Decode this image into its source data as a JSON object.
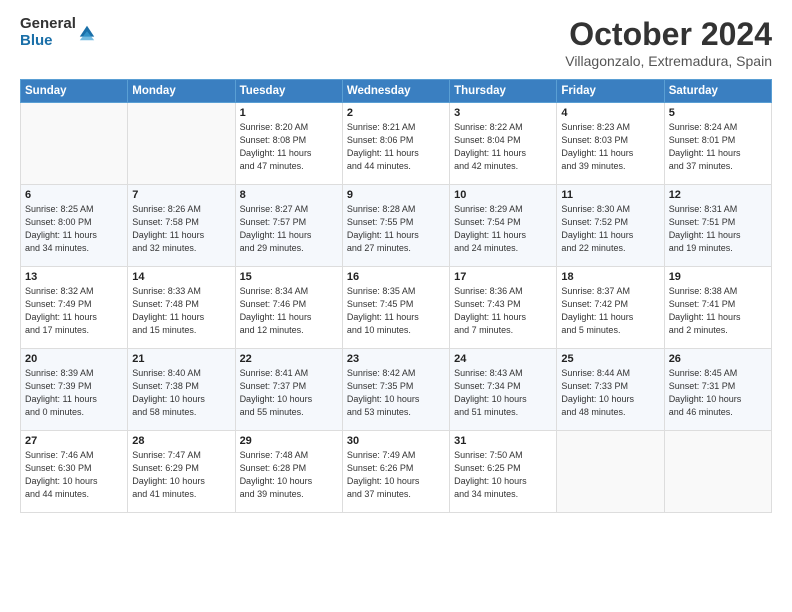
{
  "logo": {
    "general": "General",
    "blue": "Blue"
  },
  "title": "October 2024",
  "location": "Villagonzalo, Extremadura, Spain",
  "headers": [
    "Sunday",
    "Monday",
    "Tuesday",
    "Wednesday",
    "Thursday",
    "Friday",
    "Saturday"
  ],
  "weeks": [
    [
      {
        "day": "",
        "info": ""
      },
      {
        "day": "",
        "info": ""
      },
      {
        "day": "1",
        "info": "Sunrise: 8:20 AM\nSunset: 8:08 PM\nDaylight: 11 hours\nand 47 minutes."
      },
      {
        "day": "2",
        "info": "Sunrise: 8:21 AM\nSunset: 8:06 PM\nDaylight: 11 hours\nand 44 minutes."
      },
      {
        "day": "3",
        "info": "Sunrise: 8:22 AM\nSunset: 8:04 PM\nDaylight: 11 hours\nand 42 minutes."
      },
      {
        "day": "4",
        "info": "Sunrise: 8:23 AM\nSunset: 8:03 PM\nDaylight: 11 hours\nand 39 minutes."
      },
      {
        "day": "5",
        "info": "Sunrise: 8:24 AM\nSunset: 8:01 PM\nDaylight: 11 hours\nand 37 minutes."
      }
    ],
    [
      {
        "day": "6",
        "info": "Sunrise: 8:25 AM\nSunset: 8:00 PM\nDaylight: 11 hours\nand 34 minutes."
      },
      {
        "day": "7",
        "info": "Sunrise: 8:26 AM\nSunset: 7:58 PM\nDaylight: 11 hours\nand 32 minutes."
      },
      {
        "day": "8",
        "info": "Sunrise: 8:27 AM\nSunset: 7:57 PM\nDaylight: 11 hours\nand 29 minutes."
      },
      {
        "day": "9",
        "info": "Sunrise: 8:28 AM\nSunset: 7:55 PM\nDaylight: 11 hours\nand 27 minutes."
      },
      {
        "day": "10",
        "info": "Sunrise: 8:29 AM\nSunset: 7:54 PM\nDaylight: 11 hours\nand 24 minutes."
      },
      {
        "day": "11",
        "info": "Sunrise: 8:30 AM\nSunset: 7:52 PM\nDaylight: 11 hours\nand 22 minutes."
      },
      {
        "day": "12",
        "info": "Sunrise: 8:31 AM\nSunset: 7:51 PM\nDaylight: 11 hours\nand 19 minutes."
      }
    ],
    [
      {
        "day": "13",
        "info": "Sunrise: 8:32 AM\nSunset: 7:49 PM\nDaylight: 11 hours\nand 17 minutes."
      },
      {
        "day": "14",
        "info": "Sunrise: 8:33 AM\nSunset: 7:48 PM\nDaylight: 11 hours\nand 15 minutes."
      },
      {
        "day": "15",
        "info": "Sunrise: 8:34 AM\nSunset: 7:46 PM\nDaylight: 11 hours\nand 12 minutes."
      },
      {
        "day": "16",
        "info": "Sunrise: 8:35 AM\nSunset: 7:45 PM\nDaylight: 11 hours\nand 10 minutes."
      },
      {
        "day": "17",
        "info": "Sunrise: 8:36 AM\nSunset: 7:43 PM\nDaylight: 11 hours\nand 7 minutes."
      },
      {
        "day": "18",
        "info": "Sunrise: 8:37 AM\nSunset: 7:42 PM\nDaylight: 11 hours\nand 5 minutes."
      },
      {
        "day": "19",
        "info": "Sunrise: 8:38 AM\nSunset: 7:41 PM\nDaylight: 11 hours\nand 2 minutes."
      }
    ],
    [
      {
        "day": "20",
        "info": "Sunrise: 8:39 AM\nSunset: 7:39 PM\nDaylight: 11 hours\nand 0 minutes."
      },
      {
        "day": "21",
        "info": "Sunrise: 8:40 AM\nSunset: 7:38 PM\nDaylight: 10 hours\nand 58 minutes."
      },
      {
        "day": "22",
        "info": "Sunrise: 8:41 AM\nSunset: 7:37 PM\nDaylight: 10 hours\nand 55 minutes."
      },
      {
        "day": "23",
        "info": "Sunrise: 8:42 AM\nSunset: 7:35 PM\nDaylight: 10 hours\nand 53 minutes."
      },
      {
        "day": "24",
        "info": "Sunrise: 8:43 AM\nSunset: 7:34 PM\nDaylight: 10 hours\nand 51 minutes."
      },
      {
        "day": "25",
        "info": "Sunrise: 8:44 AM\nSunset: 7:33 PM\nDaylight: 10 hours\nand 48 minutes."
      },
      {
        "day": "26",
        "info": "Sunrise: 8:45 AM\nSunset: 7:31 PM\nDaylight: 10 hours\nand 46 minutes."
      }
    ],
    [
      {
        "day": "27",
        "info": "Sunrise: 7:46 AM\nSunset: 6:30 PM\nDaylight: 10 hours\nand 44 minutes."
      },
      {
        "day": "28",
        "info": "Sunrise: 7:47 AM\nSunset: 6:29 PM\nDaylight: 10 hours\nand 41 minutes."
      },
      {
        "day": "29",
        "info": "Sunrise: 7:48 AM\nSunset: 6:28 PM\nDaylight: 10 hours\nand 39 minutes."
      },
      {
        "day": "30",
        "info": "Sunrise: 7:49 AM\nSunset: 6:26 PM\nDaylight: 10 hours\nand 37 minutes."
      },
      {
        "day": "31",
        "info": "Sunrise: 7:50 AM\nSunset: 6:25 PM\nDaylight: 10 hours\nand 34 minutes."
      },
      {
        "day": "",
        "info": ""
      },
      {
        "day": "",
        "info": ""
      }
    ]
  ]
}
